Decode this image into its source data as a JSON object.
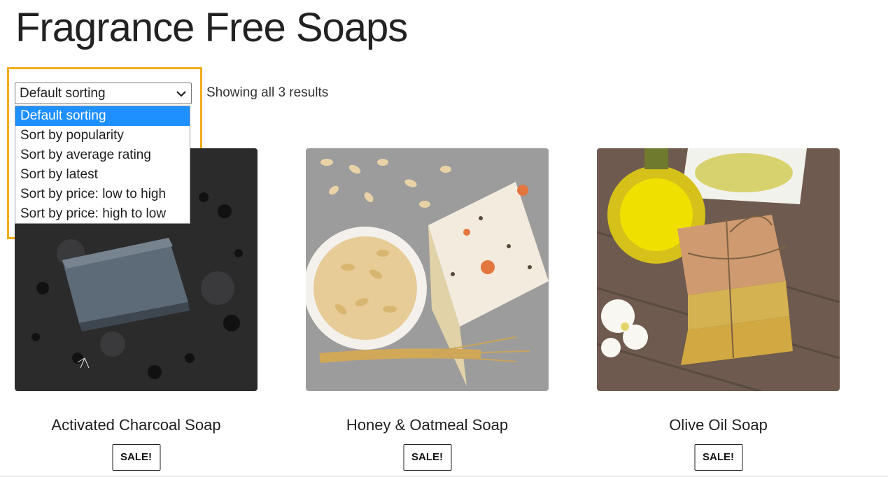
{
  "page": {
    "title": "Fragrance Free Soaps"
  },
  "sorting": {
    "selected": "Default sorting",
    "options": [
      "Default sorting",
      "Sort by popularity",
      "Sort by average rating",
      "Sort by latest",
      "Sort by price: low to high",
      "Sort by price: high to low"
    ],
    "highlight_color": "#f2ad1d",
    "selected_color": "#1e90ff"
  },
  "results": {
    "count_text": "Showing all 3 results"
  },
  "products": [
    {
      "name": "Activated Charcoal Soap",
      "badge": "SALE!"
    },
    {
      "name": "Honey & Oatmeal Soap",
      "badge": "SALE!"
    },
    {
      "name": "Olive Oil Soap",
      "badge": "SALE!"
    }
  ]
}
